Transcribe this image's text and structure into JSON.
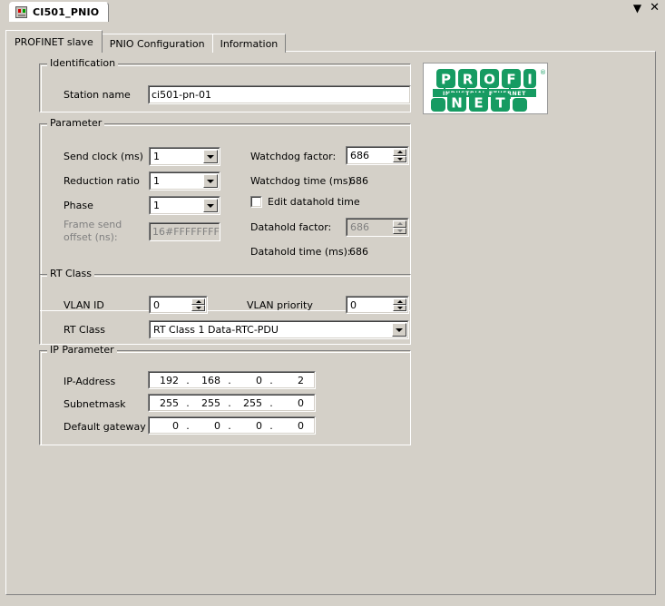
{
  "window": {
    "document_tab_title": "CI501_PNIO",
    "document_tab_icon": "module-icon",
    "minimize_glyph": "▼",
    "close_glyph": "✕"
  },
  "tabs": [
    {
      "label": "PROFINET slave",
      "active": true
    },
    {
      "label": "PNIO Configuration",
      "active": false
    },
    {
      "label": "Information",
      "active": false
    }
  ],
  "identification": {
    "title": "Identification",
    "station_name_label": "Station name",
    "station_name_value": "ci501-pn-01"
  },
  "parameter": {
    "title": "Parameter",
    "send_clock_label": "Send clock (ms)",
    "send_clock_value": "1",
    "reduction_ratio_label": "Reduction ratio",
    "reduction_ratio_value": "1",
    "phase_label": "Phase",
    "phase_value": "1",
    "frame_send_offset_label_line1": "Frame send",
    "frame_send_offset_label_line2": "offset (ns):",
    "frame_send_offset_value": "16#FFFFFFFF",
    "watchdog_factor_label": "Watchdog factor:",
    "watchdog_factor_value": "686",
    "watchdog_time_label": "Watchdog time (ms):",
    "watchdog_time_value": "686",
    "edit_datahold_time_label": "Edit datahold time",
    "edit_datahold_time_checked": false,
    "datahold_factor_label": "Datahold factor:",
    "datahold_factor_value": "686",
    "datahold_time_label": "Datahold time (ms):",
    "datahold_time_value": "686"
  },
  "rt_class": {
    "title": "RT Class",
    "vlan_id_label": "VLAN ID",
    "vlan_id_value": "0",
    "vlan_priority_label": "VLAN priority",
    "vlan_priority_value": "0",
    "rt_class_label": "RT Class",
    "rt_class_value": "RT Class 1 Data-RTC-PDU"
  },
  "ip_parameter": {
    "title": "IP Parameter",
    "ip_address_label": "IP-Address",
    "ip_address_octets": [
      "192",
      "168",
      "0",
      "2"
    ],
    "subnetmask_label": "Subnetmask",
    "subnetmask_octets": [
      "255",
      "255",
      "255",
      "0"
    ],
    "default_gateway_label": "Default gateway",
    "default_gateway_octets": [
      "0",
      "0",
      "0",
      "0"
    ],
    "separator": "."
  },
  "logo": {
    "name": "profinet-logo",
    "top_letters": [
      "P",
      "R",
      "O",
      "F",
      "I"
    ],
    "bottom_letters": [
      "N",
      "E",
      "T"
    ],
    "tagline": "INDUSTRIAL ETHERNET",
    "registered_mark": "®",
    "color": "#169b62"
  }
}
